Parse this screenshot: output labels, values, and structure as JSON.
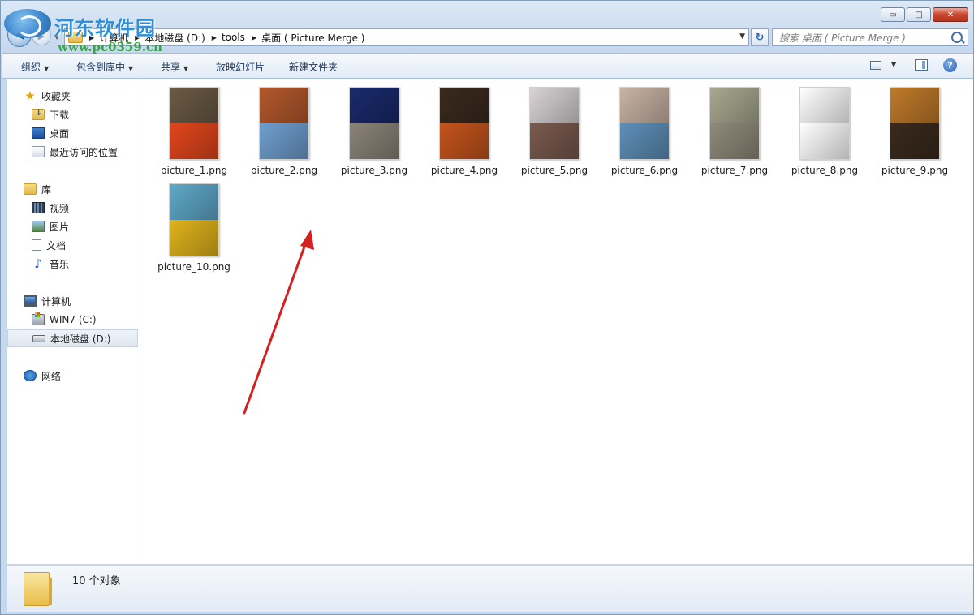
{
  "watermark": {
    "title": "河东软件园",
    "url": "www.pc0359.cn"
  },
  "window_controls": {
    "minimize": "▭",
    "maximize": "□",
    "close": "✕"
  },
  "address": {
    "crumbs": [
      "计算机",
      "本地磁盘 (D:)",
      "tools",
      "桌面 ( Picture Merge )"
    ]
  },
  "search": {
    "placeholder": "搜索 桌面 ( Picture Merge )"
  },
  "toolbar": {
    "organize": "组织",
    "include_library": "包含到库中",
    "share": "共享",
    "slideshow": "放映幻灯片",
    "new_folder": "新建文件夹",
    "help": "?"
  },
  "nav": {
    "favorites": "收藏夹",
    "downloads": "下载",
    "desktop": "桌面",
    "recent": "最近访问的位置",
    "libraries": "库",
    "videos": "视频",
    "pictures": "图片",
    "documents": "文档",
    "music": "音乐",
    "computer": "计算机",
    "drive_c": "WIN7 (C:)",
    "drive_d": "本地磁盘 (D:)",
    "network": "网络"
  },
  "files": [
    {
      "name": "picture_1.png",
      "top_color": "#6b5a45",
      "bottom_color": "#e2461c"
    },
    {
      "name": "picture_2.png",
      "top_color": "#b4582c",
      "bottom_color": "#6f9fcf"
    },
    {
      "name": "picture_3.png",
      "top_color": "#1a2a6c",
      "bottom_color": "#8a8478"
    },
    {
      "name": "picture_4.png",
      "top_color": "#3b2a1e",
      "bottom_color": "#c4541d"
    },
    {
      "name": "picture_5.png",
      "top_color": "#d9d3d6",
      "bottom_color": "#7a5a4e"
    },
    {
      "name": "picture_6.png",
      "top_color": "#c9b4a5",
      "bottom_color": "#5e8fb8"
    },
    {
      "name": "picture_7.png",
      "top_color": "#a8a890",
      "bottom_color": "#8f8a7a"
    },
    {
      "name": "picture_8.png",
      "top_color": "#ffffff",
      "bottom_color": "#ffffff"
    },
    {
      "name": "picture_9.png",
      "top_color": "#c07a2a",
      "bottom_color": "#3a2a1c"
    },
    {
      "name": "picture_10.png",
      "top_color": "#5fa9c9",
      "bottom_color": "#e0b41c"
    }
  ],
  "status": {
    "count_text": "10 个对象"
  },
  "colors": {
    "annotation_arrow": "#d62020",
    "window_frame": "#c9dcef",
    "selection": "#dfe7f1"
  }
}
